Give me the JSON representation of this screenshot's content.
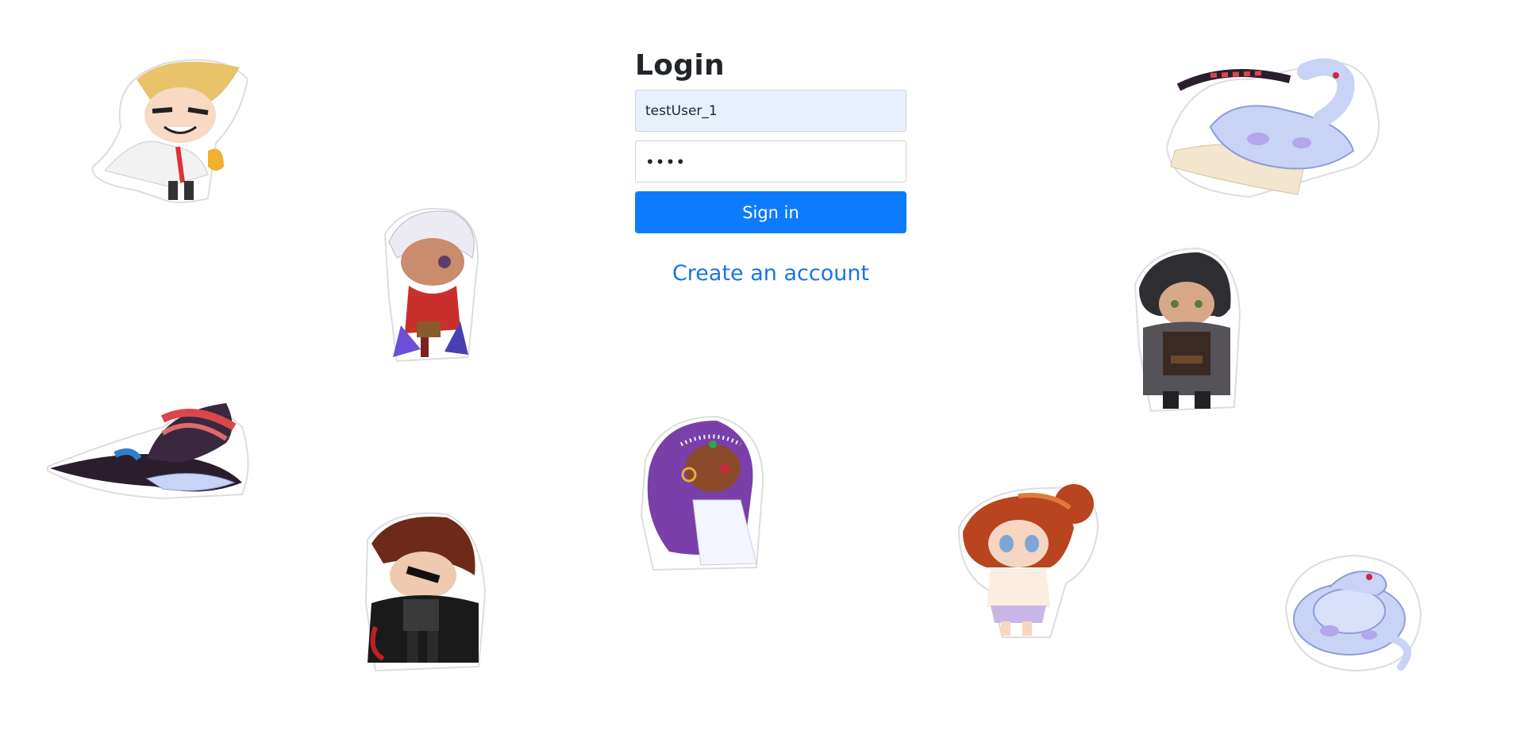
{
  "login": {
    "title": "Login",
    "username_value": "testUser_1",
    "password_value": "1234",
    "signin_label": "Sign in",
    "create_label": "Create an account"
  },
  "colors": {
    "primary": "#0d7bff",
    "link": "#1a73e8",
    "autofill_bg": "#e8f0fe",
    "snake": "#c9d3f5"
  },
  "stickers": [
    {
      "name": "blonde-knight-sticker",
      "icon": "chibi-blonde-knight"
    },
    {
      "name": "white-haired-rogue-sticker",
      "icon": "chibi-white-haired-rogue"
    },
    {
      "name": "witch-hat-snake-sticker",
      "icon": "witch-hat-with-snake"
    },
    {
      "name": "eyepatch-vampire-sticker",
      "icon": "chibi-eyepatch-vampire"
    },
    {
      "name": "purple-haired-sorceress-sticker",
      "icon": "chibi-purple-haired-sorceress"
    },
    {
      "name": "red-haired-girl-sticker",
      "icon": "chibi-red-haired-girl"
    },
    {
      "name": "dark-haired-ranger-sticker",
      "icon": "chibi-dark-haired-ranger"
    },
    {
      "name": "snake-on-scroll-sticker",
      "icon": "snake-on-scroll"
    },
    {
      "name": "coiled-snake-sticker",
      "icon": "coiled-snake"
    }
  ]
}
